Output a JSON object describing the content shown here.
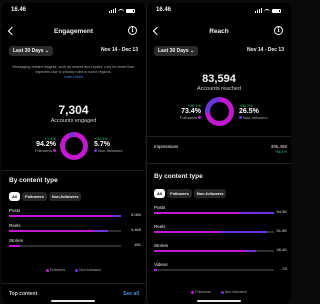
{
  "left": {
    "status_time": "16.46",
    "title": "Engagement",
    "range_label": "Last 30 Days ⌄",
    "date_range": "Nov 14 - Dec 13",
    "notice": "Messaging-related insights, such as shares and replies, may be lower than expected due to privacy rules in some regions.",
    "learn_more": "Learn More",
    "total": "7,304",
    "total_label": "Accounts engaged",
    "followers_change": "+1.4%",
    "followers_pct": "94.2%",
    "followers_label": "Followers",
    "nonfollowers_change": "+33.3%",
    "nonfollowers_pct": "5.7%",
    "nonfollowers_label": "Non-followers",
    "donut_followers_fraction": 0.942,
    "section_title": "By content type",
    "filters": [
      "All",
      "Followers",
      "Non-followers"
    ],
    "rows": [
      {
        "label": "Posts",
        "value": "5,060",
        "followers_fraction": 0.92,
        "nonfollowers_fraction": 0.08,
        "total_fraction": 1.0
      },
      {
        "label": "Reels",
        "value": "4,465",
        "followers_fraction": 0.86,
        "nonfollowers_fraction": 0.14,
        "total_fraction": 0.88
      },
      {
        "label": "Stories",
        "value": "481",
        "followers_fraction": 0.95,
        "nonfollowers_fraction": 0.05,
        "total_fraction": 0.095
      }
    ],
    "legend_followers": "Followers",
    "legend_nonfollowers": "Non-followers",
    "next_section": "Top content",
    "see_all": "See all"
  },
  "right": {
    "status_time": "16.46",
    "title": "Reach",
    "range_label": "Last 30 Days ⌄",
    "date_range": "Nov 14 - Dec 13",
    "total": "83,594",
    "total_label": "Accounts reached",
    "followers_change": "+36.1%",
    "followers_pct": "73.4%",
    "followers_label": "Followers",
    "nonfollowers_change": "+86.7%",
    "nonfollowers_pct": "26.5%",
    "nonfollowers_label": "Non-followers",
    "donut_followers_fraction": 0.734,
    "impressions_label": "Impressions",
    "impressions_value": "395,468",
    "impressions_change": "+56.1%",
    "section_title": "By content type",
    "filters": [
      "All",
      "Followers",
      "Non-followers"
    ],
    "rows": [
      {
        "label": "Posts",
        "value": "54.5K",
        "followers_fraction": 0.72,
        "nonfollowers_fraction": 0.28,
        "total_fraction": 1.0
      },
      {
        "label": "Reels",
        "value": "51.5K",
        "followers_fraction": 0.6,
        "nonfollowers_fraction": 0.4,
        "total_fraction": 0.94
      },
      {
        "label": "Stories",
        "value": "46.4K",
        "followers_fraction": 0.9,
        "nonfollowers_fraction": 0.1,
        "total_fraction": 0.85
      },
      {
        "label": "Videos",
        "value": "23",
        "followers_fraction": 0.7,
        "nonfollowers_fraction": 0.3,
        "total_fraction": 0.02
      }
    ],
    "legend_followers": "Followers",
    "legend_nonfollowers": "Non-followers"
  },
  "colors": {
    "followers": "#c218d0",
    "nonfollowers": "#6a35d9",
    "donut_track": "#2a2a2a",
    "positive": "#2ecc71",
    "link": "#4a90e2"
  },
  "icons": [
    "back-chevron-icon",
    "info-icon",
    "signal-icon",
    "wifi-icon",
    "battery-icon"
  ]
}
